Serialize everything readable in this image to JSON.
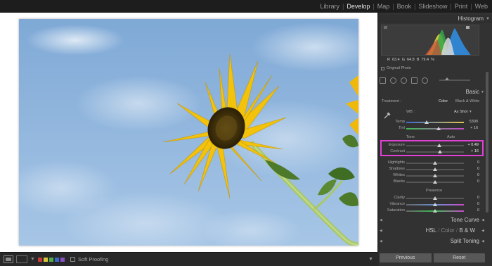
{
  "modules": [
    {
      "label": "Library",
      "active": false
    },
    {
      "label": "Develop",
      "active": true
    },
    {
      "label": "Map",
      "active": false
    },
    {
      "label": "Book",
      "active": false
    },
    {
      "label": "Slideshow",
      "active": false
    },
    {
      "label": "Print",
      "active": false
    },
    {
      "label": "Web",
      "active": false
    }
  ],
  "histogram": {
    "title": "Histogram",
    "readout": {
      "r_label": "R",
      "r": "63.4",
      "g_label": "G",
      "g": "64.8",
      "b_label": "B",
      "b": "79.4",
      "pct": "%"
    },
    "original_photo": "Original Photo"
  },
  "basic": {
    "title": "Basic",
    "treatment_label": "Treatment :",
    "treatment_color": "Color",
    "treatment_bw": "Black & White",
    "wb_label": "WB :",
    "wb_value": "As Shot",
    "temp_label": "Temp",
    "temp_value": "5300",
    "tint_label": "Tint",
    "tint_value": "+ 16",
    "tone_label": "Tone",
    "tone_auto": "Auto",
    "exposure_label": "Exposure",
    "exposure_value": "+ 0.49",
    "contrast_label": "Contrast",
    "contrast_value": "+ 16",
    "highlights_label": "Highlights",
    "highlights_value": "0",
    "shadows_label": "Shadows",
    "shadows_value": "0",
    "whites_label": "Whites",
    "whites_value": "0",
    "blacks_label": "Blacks",
    "blacks_value": "0",
    "presence_label": "Presence",
    "clarity_label": "Clarity",
    "clarity_value": "0",
    "vibrance_label": "Vibrance",
    "vibrance_value": "0",
    "saturation_label": "Saturation",
    "saturation_value": "0"
  },
  "sections": {
    "tone_curve": "Tone Curve",
    "hsl": "HSL",
    "color": "Color",
    "bw": "B & W",
    "split_toning": "Split Toning"
  },
  "buttons": {
    "previous": "Previous",
    "reset": "Reset"
  },
  "toolbar": {
    "soft_proofing": "Soft Proofing"
  },
  "colors": {
    "highlight": "#e040d6",
    "panel": "#323232",
    "sky": "#8fb7dd"
  }
}
